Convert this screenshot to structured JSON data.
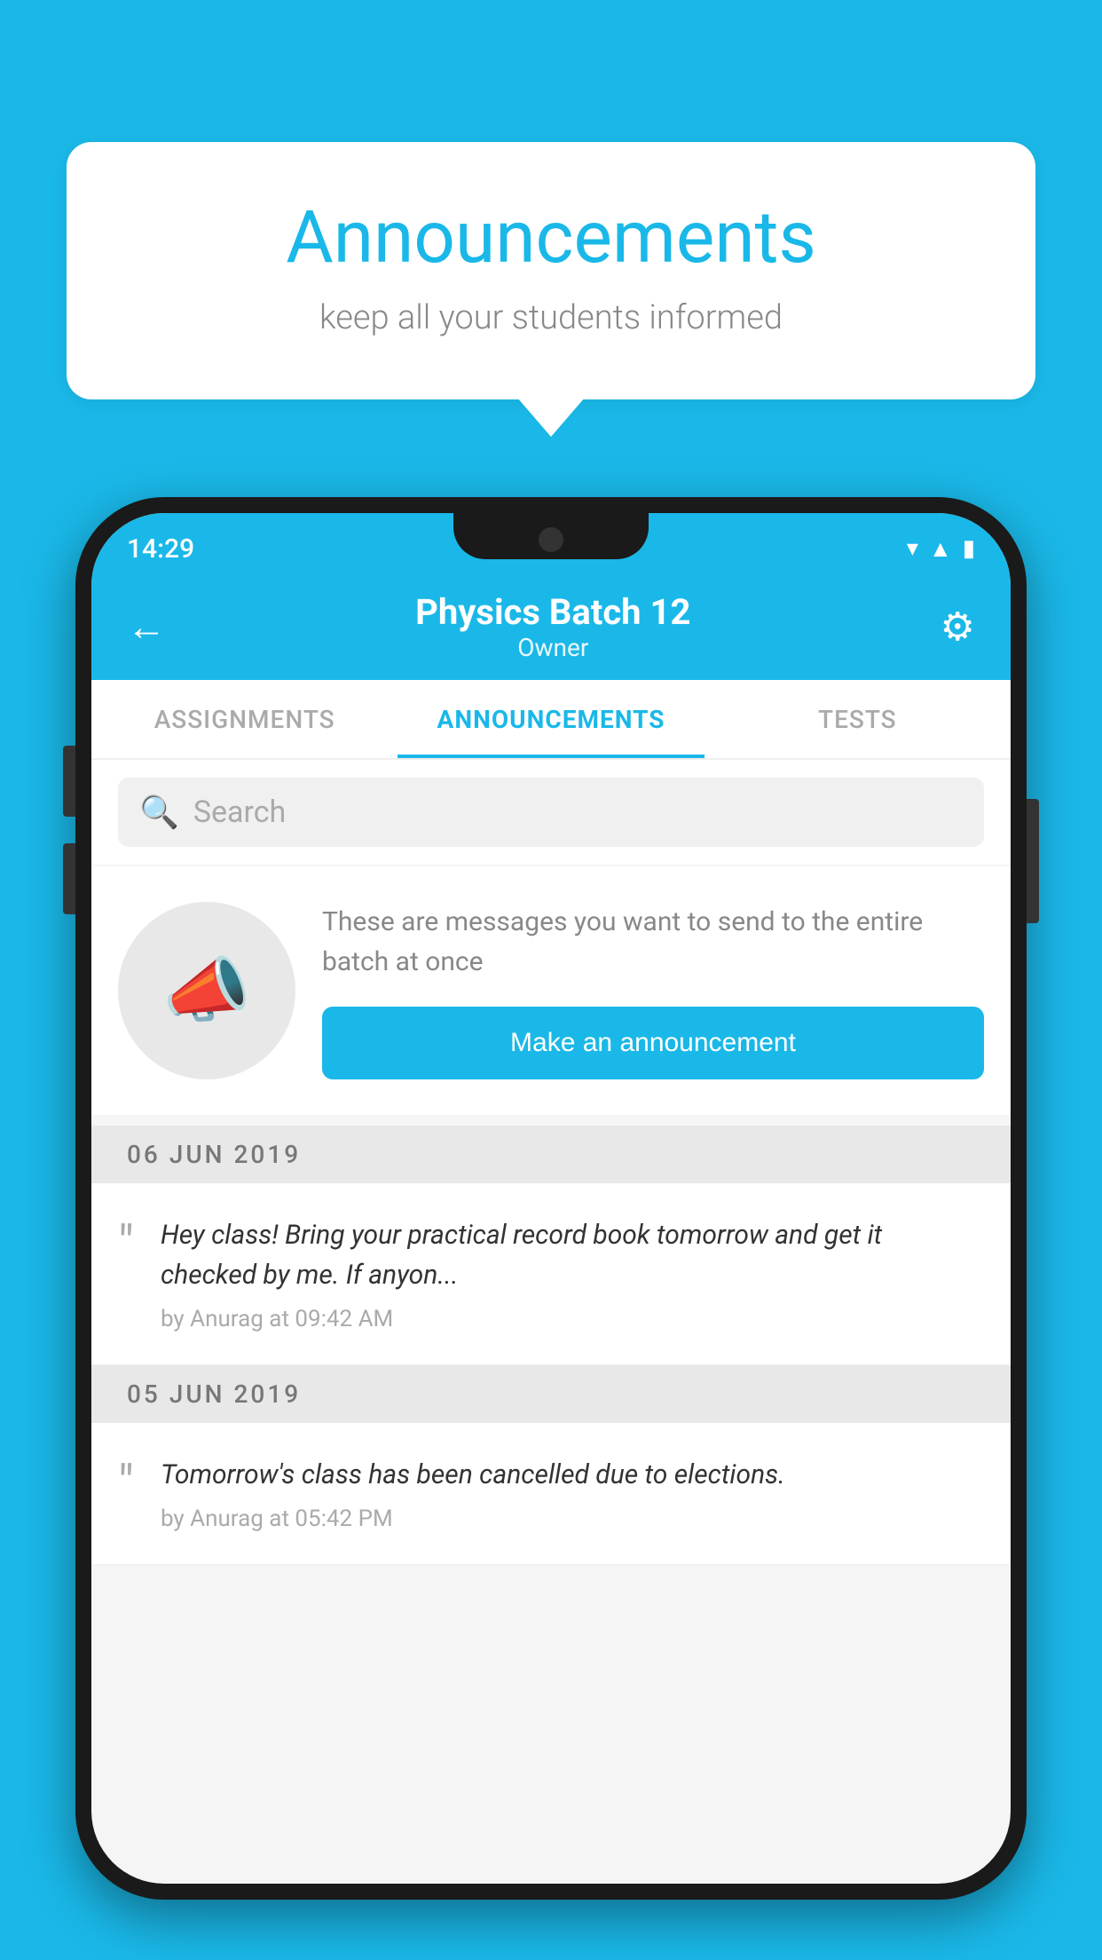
{
  "background": {
    "color": "#1ab8e8"
  },
  "speech_bubble": {
    "title": "Announcements",
    "subtitle": "keep all your students informed"
  },
  "phone": {
    "status_bar": {
      "time": "14:29",
      "wifi_icon": "▲",
      "signal_icon": "▲",
      "battery_icon": "▮"
    },
    "header": {
      "title": "Physics Batch 12",
      "subtitle": "Owner",
      "back_label": "←",
      "settings_label": "⚙"
    },
    "tabs": [
      {
        "label": "ASSIGNMENTS",
        "active": false
      },
      {
        "label": "ANNOUNCEMENTS",
        "active": true
      },
      {
        "label": "TESTS",
        "active": false
      }
    ],
    "search": {
      "placeholder": "Search"
    },
    "promo": {
      "description": "These are messages you want to send to the entire batch at once",
      "button_label": "Make an announcement"
    },
    "announcements": [
      {
        "date": "06  JUN  2019",
        "text": "Hey class! Bring your practical record book tomorrow and get it checked by me. If anyon...",
        "meta": "by Anurag at 09:42 AM"
      },
      {
        "date": "05  JUN  2019",
        "text": "Tomorrow's class has been cancelled due to elections.",
        "meta": "by Anurag at 05:42 PM"
      }
    ]
  }
}
